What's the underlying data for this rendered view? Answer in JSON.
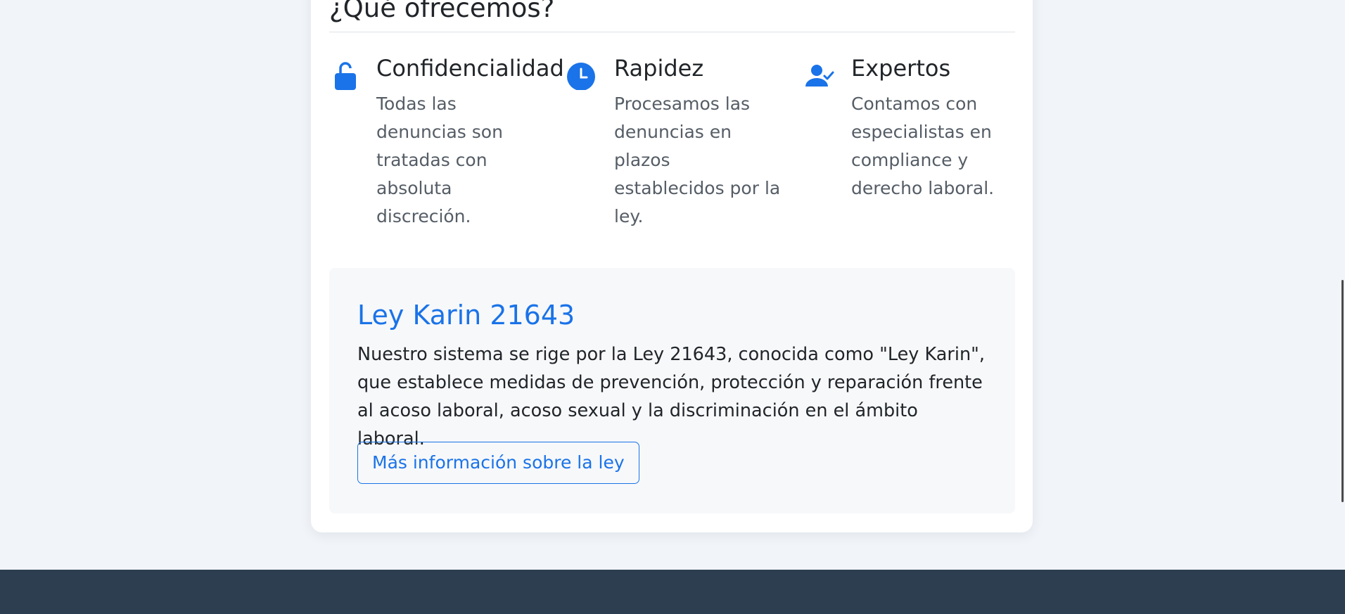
{
  "offer_section": {
    "title": "¿Qué ofrecemos?",
    "features": [
      {
        "icon": "lock-icon",
        "title": "Confidencialidad",
        "description": "Todas las denuncias son tratadas con absoluta discreción."
      },
      {
        "icon": "clock-icon",
        "title": "Rapidez",
        "description": "Procesamos las denuncias en plazos establecidos por la ley."
      },
      {
        "icon": "user-check-icon",
        "title": "Expertos",
        "description": "Contamos con especialistas en compliance y derecho laboral."
      }
    ]
  },
  "law_section": {
    "title": "Ley Karin 21643",
    "description": "Nuestro sistema se rige por la Ley 21643, conocida como \"Ley Karin\", que establece medidas de prevención, protección y reparación frente al acoso laboral, acoso sexual y la discriminación en el ámbito laboral.",
    "button_label": "Más información sobre la ley"
  },
  "colors": {
    "accent": "#1a73e8",
    "page_background": "#f1f4f8",
    "footer": "#2c3e50"
  }
}
